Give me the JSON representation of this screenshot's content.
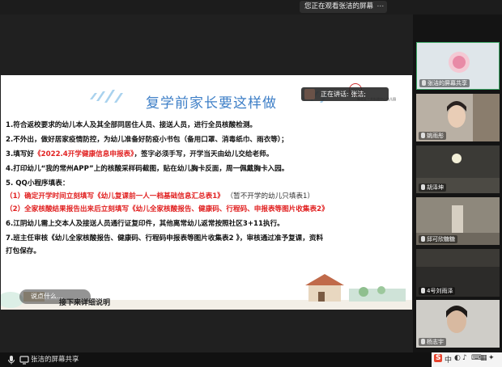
{
  "top_bar": {
    "share_notice": "您正在观看张洁的屏幕",
    "menu_glyph": "⋯"
  },
  "speaking_banner": {
    "text": "正在讲话: 张洁;"
  },
  "slide": {
    "title": "复学前家长要这样做",
    "school_name": "新北区三井街道中心幼儿园",
    "lines": [
      {
        "parts": [
          {
            "t": "1.符合返校要求的幼儿本人及其全部同居住人员、接送人员，进行全员核酸检测。",
            "c": "n"
          }
        ]
      },
      {
        "parts": [
          {
            "t": "2.不外出，做好居家疫情防控，为幼儿准备好防疫小书包（备用口罩、消毒纸巾、雨衣等）；",
            "c": "n"
          }
        ]
      },
      {
        "parts": [
          {
            "t": "3.填写好",
            "c": "n"
          },
          {
            "t": "《2022.4开学健康信息申报表》",
            "c": "r"
          },
          {
            "t": "，签字必须手写，开学当天由幼儿交给老师。",
            "c": "n"
          }
        ]
      },
      {
        "parts": [
          {
            "t": "4.打印幼儿“我的常州APP”上的核酸采样码截图，贴在幼儿胸卡反面，周一佩戴胸卡入园。",
            "c": "n"
          }
        ]
      },
      {
        "parts": [
          {
            "t": "5. QQ小程序填表：",
            "c": "n"
          }
        ]
      },
      {
        "parts": [
          {
            "t": "  （1）确定开学时间立刻填写《幼儿复课前一人一档基础信息汇总表1》",
            "c": "r"
          },
          {
            "t": "  （暂不开学的幼儿只填表1）",
            "c": "g"
          }
        ]
      },
      {
        "parts": [
          {
            "t": "  （2）全家核酸结果报告出来后立刻填写《幼儿全家核酸报告、健康码、行程码、申报表等图片收集表2》",
            "c": "r"
          }
        ]
      },
      {
        "parts": [
          {
            "t": "6.江阴幼儿需上交本人及接送人员通行证复印件，其他离常幼儿返常按照社区3+11执行。",
            "c": "n"
          }
        ]
      },
      {
        "parts": [
          {
            "t": "7.班主任审核《幼儿全家核酸报告、健康码、行程码申报表等图片收集表2 》，审核通过准予复课，资料",
            "c": "n"
          }
        ]
      },
      {
        "parts": [
          {
            "t": "打包保存。",
            "c": "n"
          }
        ]
      }
    ],
    "next_caption": "接下来详细说明"
  },
  "comment_pill": {
    "text": "说点什么..."
  },
  "bottom_bar": {
    "presenter_label": "张洁的屏幕共享"
  },
  "ime": {
    "logo": "S",
    "lang": "中",
    "glyphs": [
      "◐",
      "♪",
      "⌨",
      "▦",
      "✦",
      "⚙"
    ]
  },
  "participants": [
    {
      "name": "张洁的屏幕共享",
      "top": 0
    },
    {
      "name": "姚雨彤"
    },
    {
      "name": "胡泽坤"
    },
    {
      "name": "邱可欣糖糖"
    },
    {
      "name": "4号刘雨泽"
    },
    {
      "name": "杨志宇"
    }
  ],
  "colors": {
    "title_blue": "#3e7fc7",
    "red_text": "#e12020",
    "active_border": "#3aa564"
  }
}
